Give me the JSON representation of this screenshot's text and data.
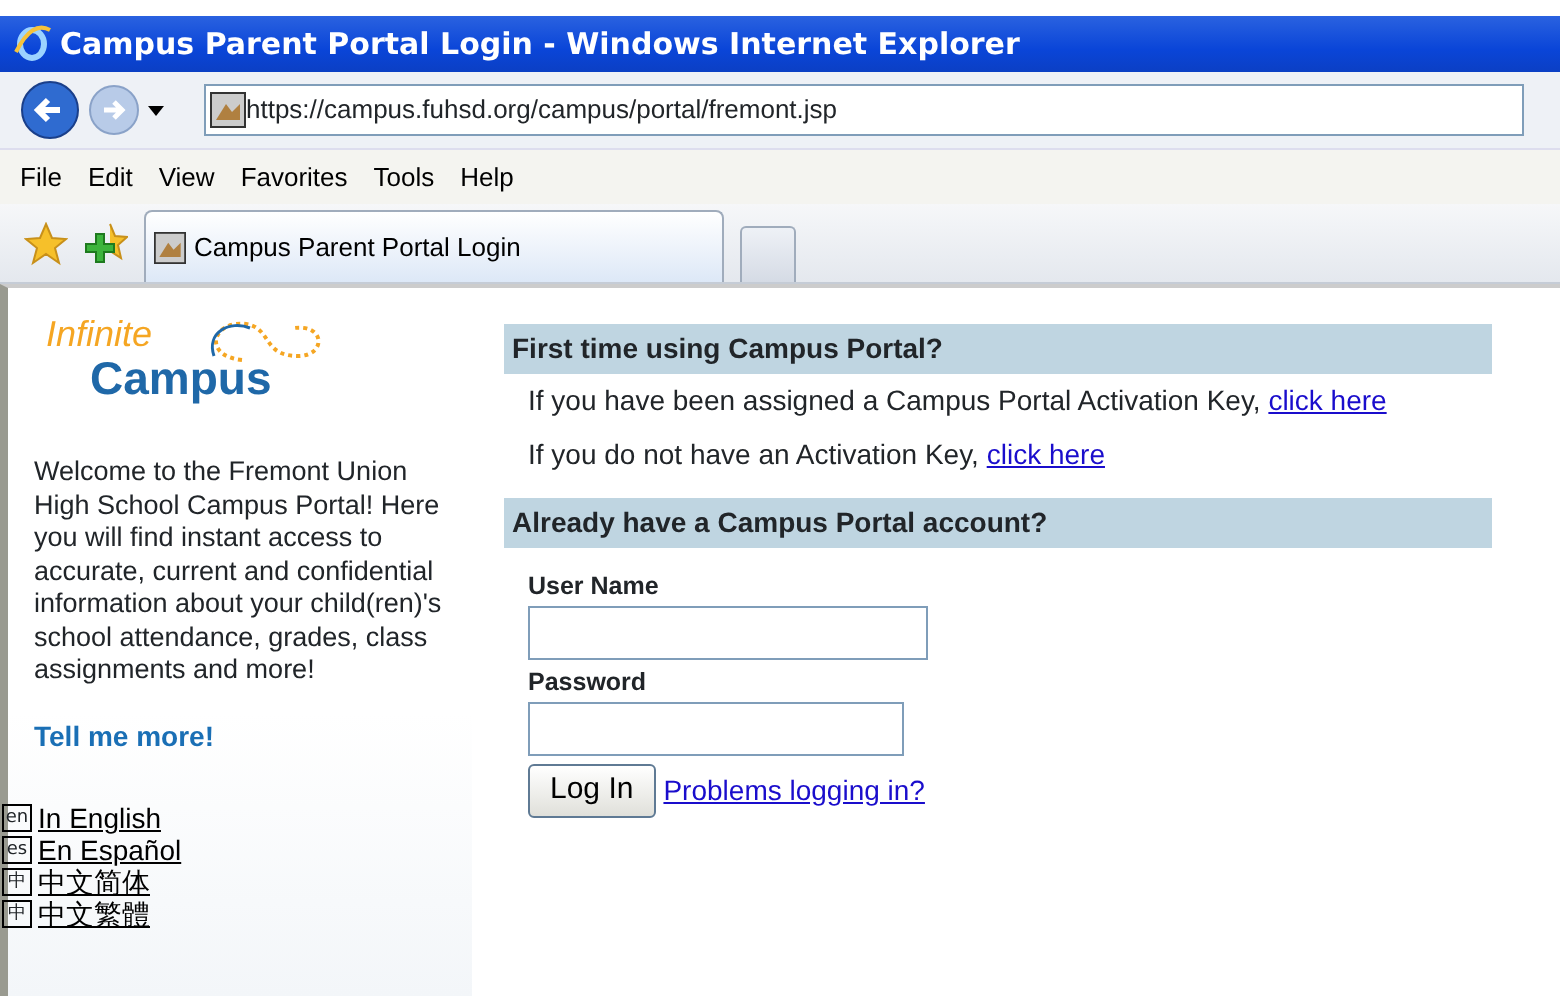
{
  "window": {
    "title": "Campus Parent Portal Login - Windows Internet Explorer"
  },
  "address_bar": {
    "url": "https://campus.fuhsd.org/campus/portal/fremont.jsp"
  },
  "menu": [
    "File",
    "Edit",
    "View",
    "Favorites",
    "Tools",
    "Help"
  ],
  "tabs": [
    {
      "label": "Campus Parent Portal Login",
      "selected": true
    }
  ],
  "logo": {
    "line_1": "Infinite",
    "line_2": "Campus"
  },
  "welcome": "Welcome to the Fremont Union High School Campus Portal! Here you will find instant access to accurate, current and confidential information about your child(ren)'s school attendance, grades, class assignments and more!",
  "tell_more": "Tell me more!",
  "languages": [
    {
      "code": "en",
      "label": "In English"
    },
    {
      "code": "es",
      "label": "En Español"
    },
    {
      "code": "中",
      "label": "中文简体"
    },
    {
      "code": "中",
      "label": "中文繁體"
    }
  ],
  "sections": [
    {
      "heading": "First time using Campus Portal?",
      "lines": [
        {
          "text": "If you have been assigned a Campus Portal Activation Key,",
          "link": "click here"
        },
        {
          "text": "If you do not have an Activation Key,",
          "link": "click here"
        }
      ]
    },
    {
      "heading": "Already have a Campus Portal account?"
    }
  ],
  "login": {
    "username_label": "User Name",
    "password_label": "Password",
    "button": "Log In",
    "help_link": "Problems logging in?"
  }
}
